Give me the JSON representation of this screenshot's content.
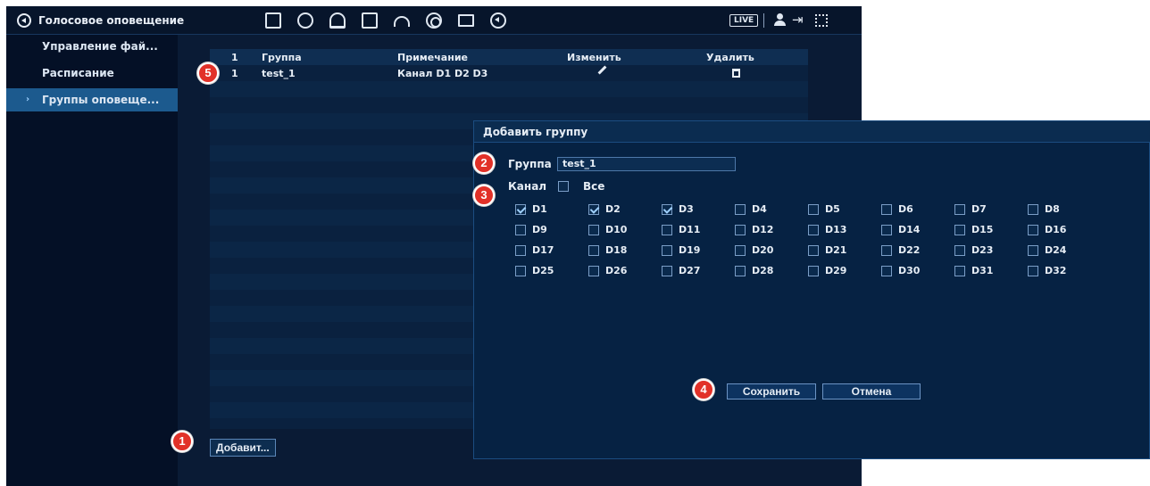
{
  "header": {
    "title": "Голосовое оповещение",
    "live_label": "LIVE"
  },
  "sidebar": {
    "items": [
      {
        "label": "Управление фай..."
      },
      {
        "label": "Расписание"
      },
      {
        "label": "Группы оповеще..."
      }
    ]
  },
  "table": {
    "headers": {
      "num": "1",
      "group": "Группа",
      "note": "Примечание",
      "edit": "Изменить",
      "delete": "Удалить"
    },
    "rows": [
      {
        "num": "1",
        "group": "test_1",
        "note": "Канал D1 D2 D3"
      }
    ]
  },
  "add_button": "Добавит...",
  "dialog": {
    "title": "Добавить группу",
    "group_label": "Группа",
    "group_value": "test_1",
    "channel_label": "Канал",
    "all_label": "Все",
    "channels": [
      {
        "name": "D1",
        "checked": true
      },
      {
        "name": "D2",
        "checked": true
      },
      {
        "name": "D3",
        "checked": true
      },
      {
        "name": "D4",
        "checked": false
      },
      {
        "name": "D5",
        "checked": false
      },
      {
        "name": "D6",
        "checked": false
      },
      {
        "name": "D7",
        "checked": false
      },
      {
        "name": "D8",
        "checked": false
      },
      {
        "name": "D9",
        "checked": false
      },
      {
        "name": "D10",
        "checked": false
      },
      {
        "name": "D11",
        "checked": false
      },
      {
        "name": "D12",
        "checked": false
      },
      {
        "name": "D13",
        "checked": false
      },
      {
        "name": "D14",
        "checked": false
      },
      {
        "name": "D15",
        "checked": false
      },
      {
        "name": "D16",
        "checked": false
      },
      {
        "name": "D17",
        "checked": false
      },
      {
        "name": "D18",
        "checked": false
      },
      {
        "name": "D19",
        "checked": false
      },
      {
        "name": "D20",
        "checked": false
      },
      {
        "name": "D21",
        "checked": false
      },
      {
        "name": "D22",
        "checked": false
      },
      {
        "name": "D23",
        "checked": false
      },
      {
        "name": "D24",
        "checked": false
      },
      {
        "name": "D25",
        "checked": false
      },
      {
        "name": "D26",
        "checked": false
      },
      {
        "name": "D27",
        "checked": false
      },
      {
        "name": "D28",
        "checked": false
      },
      {
        "name": "D29",
        "checked": false
      },
      {
        "name": "D30",
        "checked": false
      },
      {
        "name": "D31",
        "checked": false
      },
      {
        "name": "D32",
        "checked": false
      }
    ],
    "save_label": "Сохранить",
    "cancel_label": "Отмена"
  },
  "callouts": [
    "1",
    "2",
    "3",
    "4",
    "5"
  ],
  "colors": {
    "background": "#0a1b35",
    "active_item": "#1c5a8e",
    "callout": "#e23128"
  }
}
